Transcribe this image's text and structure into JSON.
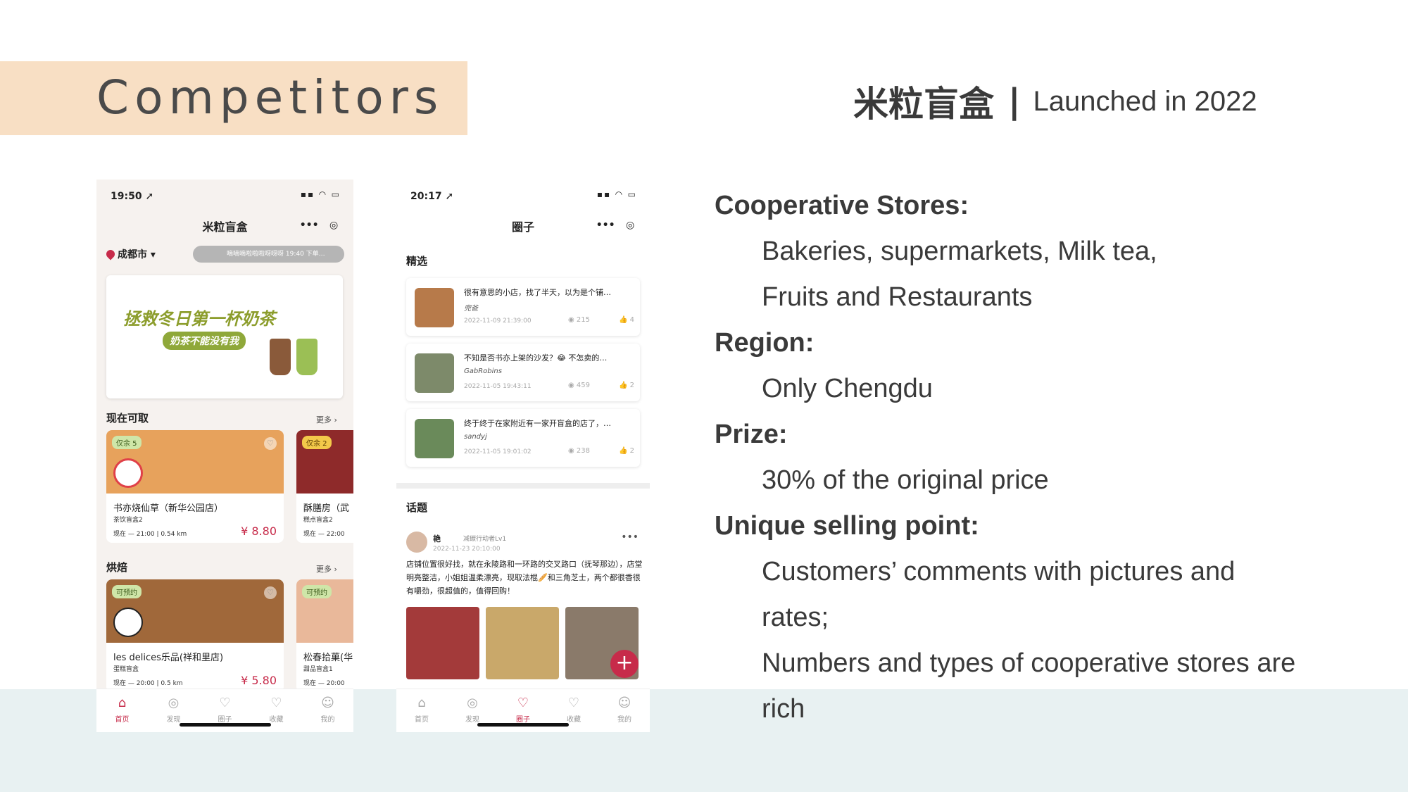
{
  "slide": {
    "title": "Competitors",
    "heading_cn": "米粒盲盒",
    "heading_sep": "|",
    "heading_en": "Launched in 2022"
  },
  "details": {
    "stores_label": "Cooperative Stores:",
    "stores_line1": "Bakeries, supermarkets, Milk tea,",
    "stores_line2": "Fruits and Restaurants",
    "region_label": "Region:",
    "region_value": "Only Chengdu",
    "prize_label": "Prize:",
    "prize_value": "30% of the original price",
    "usp_label": "Unique selling point:",
    "usp_line1": "Customers’ comments with pictures and",
    "usp_line2": "rates;",
    "usp_line3": "Numbers and types of cooperative stores are",
    "usp_line4": "rich"
  },
  "phone1": {
    "time": "19:50 ➚",
    "status_icons": "▪▪ ◠ ▭",
    "nav_title": "米粒盲盒",
    "capsule_more": "•••",
    "capsule_close": "◎",
    "location": "成都市 ▾",
    "notice": "嘀嘀嘀啦啦啦呀呀呀 19:40 下单…",
    "banner_line1": "拯救冬日第一杯奶茶",
    "banner_line2": "奶茶不能没有我",
    "section1": "现在可取",
    "section1_more": "更多 ›",
    "section2": "烘焙",
    "section2_more": "更多 ›",
    "cards": [
      {
        "badge": "仅余 5",
        "name": "书亦烧仙草（新华公园店）",
        "sub": "茶饮盲盒2",
        "meta": "现在 — 21:00 | 0.54 km",
        "price": "¥ 8.80"
      },
      {
        "badge": "仅余 2",
        "name": "酥膳房（武",
        "sub": "糕点盲盒2",
        "meta": "现在 — 22:00",
        "price": ""
      },
      {
        "badge": "可预约",
        "name": "les delices乐品(祥和里店)",
        "sub": "蛋糕盲盒",
        "meta": "现在 — 20:00 | 0.5 km",
        "price": "¥ 5.80"
      },
      {
        "badge": "可预约",
        "name": "松春拾菓(华",
        "sub": "甜品盲盒1",
        "meta": "现在 — 20:00",
        "price": ""
      }
    ],
    "tabs": [
      "首页",
      "发现",
      "圈子",
      "收藏",
      "我的"
    ]
  },
  "phone2": {
    "time": "20:17 ➚",
    "status_icons": "▪▪ ◠ ▭",
    "nav_title": "圈子",
    "capsule_more": "•••",
    "capsule_close": "◎",
    "section_featured": "精选",
    "posts": [
      {
        "title": "很有意思的小店，找了半天，以为是个铺…",
        "author": "兜爸",
        "date": "2022-11-09 21:39:00",
        "views": "◉ 215",
        "likes": "👍 4"
      },
      {
        "title": "不知是否书亦上架的沙发？😂 不怎卖的…",
        "author": "GabRobins",
        "date": "2022-11-05 19:43:11",
        "views": "◉ 459",
        "likes": "👍 2"
      },
      {
        "title": "终于终于在家附近有一家开盲盒的店了，…",
        "author": "sandyj",
        "date": "2022-11-05 19:01:02",
        "views": "◉ 238",
        "likes": "👍 2"
      }
    ],
    "section_topics": "话题",
    "topic_user": "艳",
    "topic_level": "减碳行动者Lv1",
    "topic_date": "2022-11-23 20:10:00",
    "topic_more": "•••",
    "topic_body": "店铺位置很好找，就在永陵路和一环路的交叉路口（抚琴那边），店堂明亮整洁，小姐姐温柔漂亮，现取法棍🥖和三角芝士，两个都很香很有嚼劲，很超值的，值得回购！",
    "fab": "+",
    "tabs": [
      "首页",
      "发现",
      "圈子",
      "收藏",
      "我的"
    ]
  },
  "colors": {
    "title_band": "#f8dfc4",
    "bottom_band": "#e8f1f2",
    "accent": "#c72b4a"
  },
  "icons": {
    "tab_home": "⌂",
    "tab_discover": "◎",
    "tab_circle": "♡",
    "tab_fav": "♡",
    "tab_me": "☺",
    "heart": "♡"
  }
}
